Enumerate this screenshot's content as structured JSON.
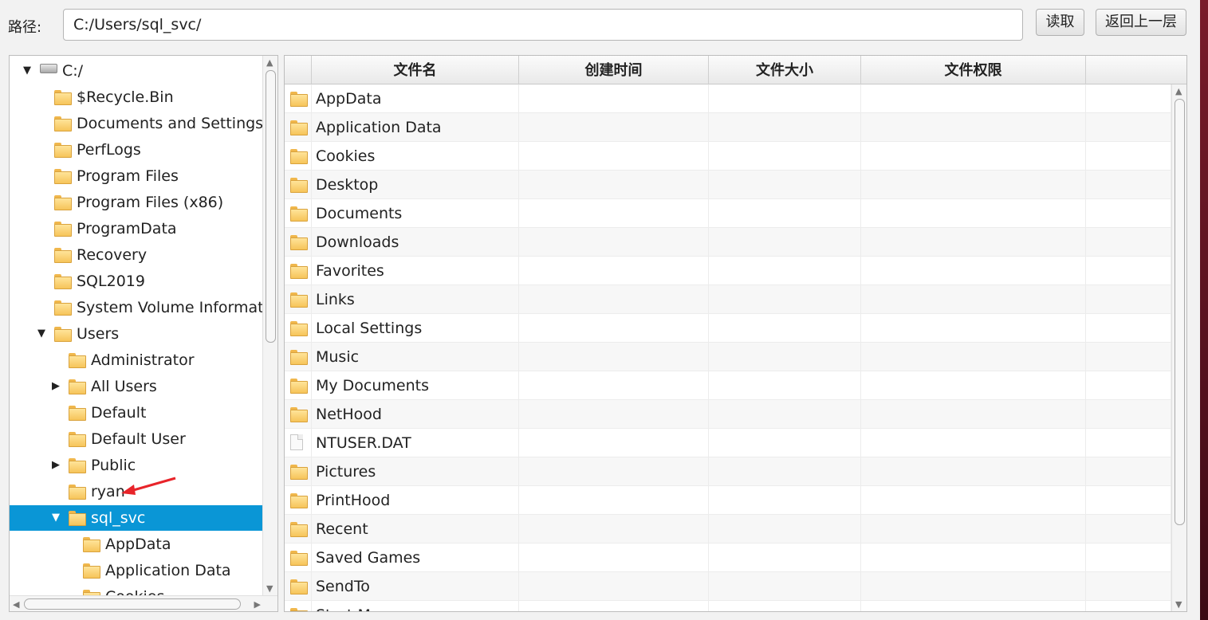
{
  "path": {
    "label": "路径:",
    "value": "C:/Users/sql_svc/"
  },
  "buttons": {
    "read": "读取",
    "up": "返回上一层"
  },
  "tree": [
    {
      "label": "C:/",
      "depth": 0,
      "expanded": true,
      "icon": "drive-icon"
    },
    {
      "label": "$Recycle.Bin",
      "depth": 1
    },
    {
      "label": "Documents and Settings",
      "depth": 1
    },
    {
      "label": "PerfLogs",
      "depth": 1
    },
    {
      "label": "Program Files",
      "depth": 1
    },
    {
      "label": "Program Files (x86)",
      "depth": 1
    },
    {
      "label": "ProgramData",
      "depth": 1
    },
    {
      "label": "Recovery",
      "depth": 1
    },
    {
      "label": "SQL2019",
      "depth": 1
    },
    {
      "label": "System Volume Informati...",
      "depth": 1
    },
    {
      "label": "Users",
      "depth": 1,
      "expanded": true
    },
    {
      "label": "Administrator",
      "depth": 2
    },
    {
      "label": "All Users",
      "depth": 2,
      "collapsed": true
    },
    {
      "label": "Default",
      "depth": 2
    },
    {
      "label": "Default User",
      "depth": 2
    },
    {
      "label": "Public",
      "depth": 2,
      "collapsed": true
    },
    {
      "label": "ryan",
      "depth": 2
    },
    {
      "label": "sql_svc",
      "depth": 2,
      "expanded": true,
      "selected": true
    },
    {
      "label": "AppData",
      "depth": 3
    },
    {
      "label": "Application Data",
      "depth": 3
    },
    {
      "label": "Cookies",
      "depth": 3
    }
  ],
  "table": {
    "columns": [
      "文件名",
      "创建时间",
      "文件大小",
      "文件权限",
      ""
    ],
    "rows": [
      {
        "name": "AppData",
        "type": "folder"
      },
      {
        "name": "Application Data",
        "type": "folder"
      },
      {
        "name": "Cookies",
        "type": "folder"
      },
      {
        "name": "Desktop",
        "type": "folder"
      },
      {
        "name": "Documents",
        "type": "folder"
      },
      {
        "name": "Downloads",
        "type": "folder"
      },
      {
        "name": "Favorites",
        "type": "folder"
      },
      {
        "name": "Links",
        "type": "folder"
      },
      {
        "name": "Local Settings",
        "type": "folder"
      },
      {
        "name": "Music",
        "type": "folder"
      },
      {
        "name": "My Documents",
        "type": "folder"
      },
      {
        "name": "NetHood",
        "type": "folder"
      },
      {
        "name": "NTUSER.DAT",
        "type": "file"
      },
      {
        "name": "Pictures",
        "type": "folder"
      },
      {
        "name": "PrintHood",
        "type": "folder"
      },
      {
        "name": "Recent",
        "type": "folder"
      },
      {
        "name": "Saved Games",
        "type": "folder"
      },
      {
        "name": "SendTo",
        "type": "folder"
      },
      {
        "name": "Start Menu",
        "type": "folder"
      }
    ]
  },
  "colors": {
    "selection": "#0a96d6",
    "folder": "#f6c45a",
    "annotation_arrow": "#e8242a"
  }
}
